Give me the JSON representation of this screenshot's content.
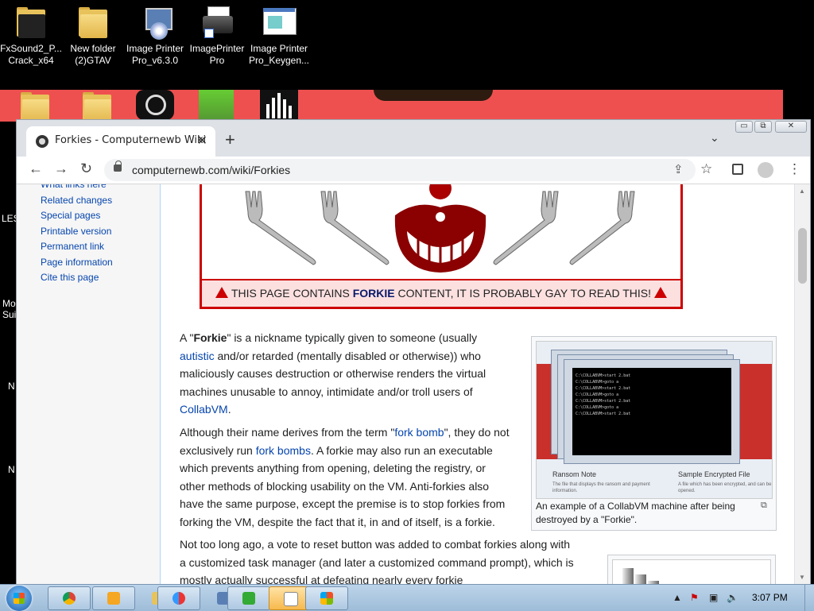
{
  "desktop": {
    "icons": [
      {
        "label": "FxSound2_P... Crack_x64"
      },
      {
        "label": "New folder (2)GTAV"
      },
      {
        "label": "Image Printer Pro_v6.3.0"
      },
      {
        "label": "ImagePrinter Pro"
      },
      {
        "label": "Image Printer Pro_Keygen..."
      }
    ],
    "edge_labels": [
      "LES",
      "Mo",
      "Sui",
      "N",
      "N"
    ]
  },
  "browser": {
    "tab_title": "Forkies - Computernewb Wiki",
    "tab_close": "✕",
    "new_tab": "+",
    "tab_menu": "⌄",
    "url": "computernewb.com/wiki/Forkies",
    "win_minimize": "▭",
    "win_restore": "⧉",
    "win_close": "✕"
  },
  "sidebar": {
    "items": [
      "What links here",
      "Related changes",
      "Special pages",
      "Printable version",
      "Permanent link",
      "Page information",
      "Cite this page"
    ]
  },
  "banner": {
    "prefix": "THIS PAGE CONTAINS ",
    "strong": "FORKIE",
    "suffix": " CONTENT, IT IS PROBABLY GAY TO READ THIS!"
  },
  "article": {
    "p1": {
      "a": "A \"",
      "b": "Forkie",
      "c": "\" is a nickname typically given to someone (usually ",
      "link1": "autistic",
      "d": " and/or retarded (mentally disabled or otherwise)) who maliciously causes destruction or otherwise renders the virtual machines unusable to annoy, intimidate and/or troll users of ",
      "link2": "CollabVM",
      "e": "."
    },
    "p2": {
      "a": "Although their name derives from the term \"",
      "link1": "fork bomb",
      "b": "\", they do not exclusively run ",
      "link2": "fork bombs",
      "c": ". A forkie may also run an executable which prevents anything from opening, deleting the registry, or other methods of blocking usability on the VM. Anti-forkies also have the same purpose, except the premise is to stop forkies from forking the VM, despite the fact that it, in and of itself, is a forkie."
    },
    "p3": "Not too long ago, a vote to reset button was added to combat forkies along with a customized task manager (and later a customized command prompt), which is mostly actually successful at defeating nearly every forkie",
    "thumb_caption": "An example of a CollabVM machine after being destroyed by a \"Forkie\".",
    "thumb_inner": {
      "ransom_note": "Ransom Note",
      "sample_file": "Sample Encrypted File",
      "ransom_desc": "The file that displays the ransom and payment information.",
      "sample_desc": "A file which has been encrypted, and can be opened.",
      "console_lines": [
        "C:\\COLLABVM>start 2.bat",
        "C:\\COLLABVM>goto a",
        "C:\\COLLABVM>start 2.bat",
        "C:\\COLLABVM>goto a",
        "C:\\COLLABVM>start 2.bat",
        "C:\\COLLABVM>goto a",
        "C:\\COLLABVM>start 2.bat"
      ]
    }
  },
  "taskbar": {
    "clock": "3:07 PM"
  },
  "colors": {
    "link": "#0645ad",
    "banner_red": "#cc0000",
    "banner_bg": "#fce0e0"
  }
}
